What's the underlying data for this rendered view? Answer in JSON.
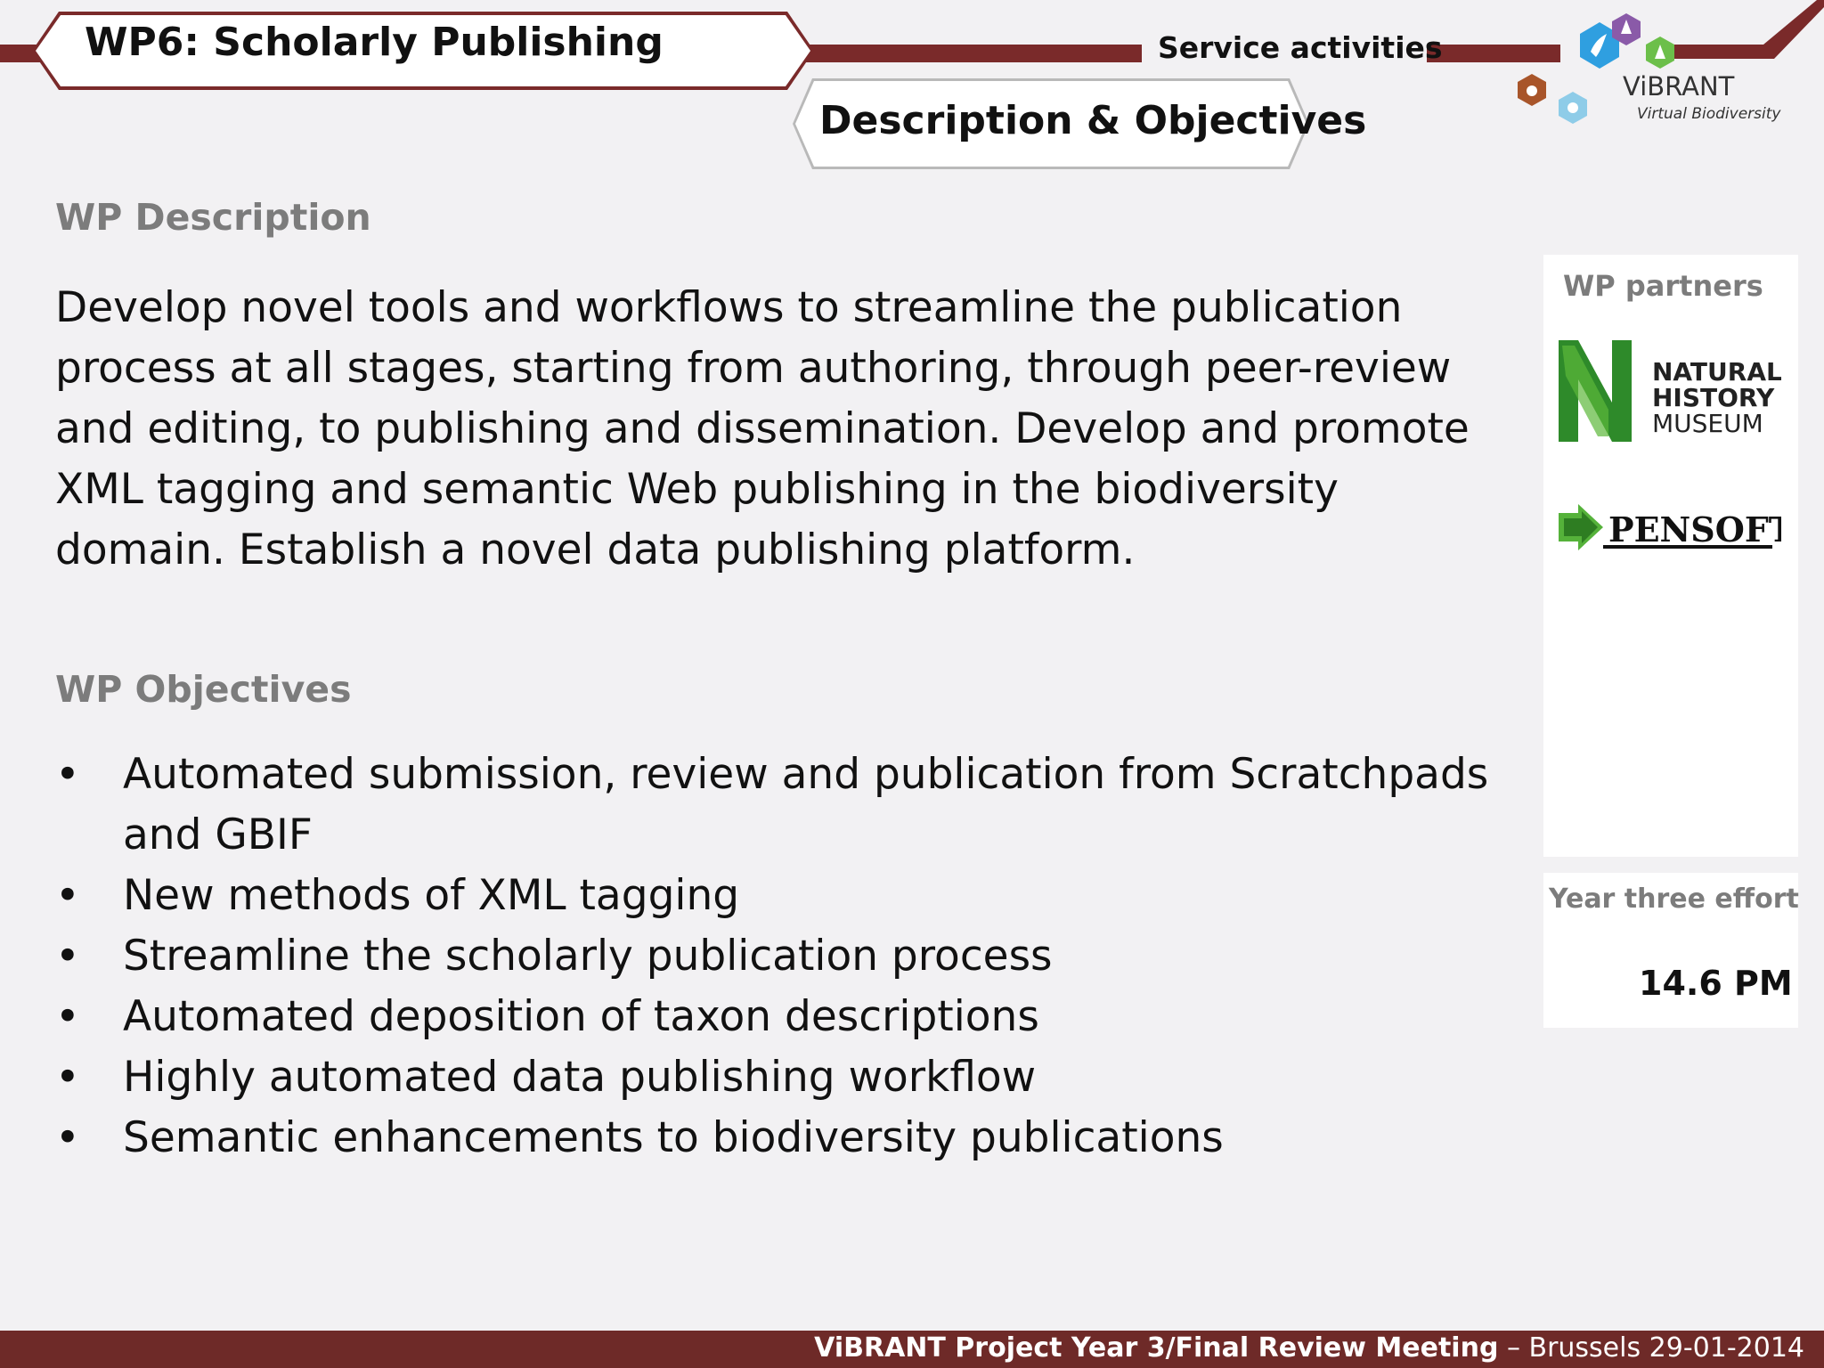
{
  "header": {
    "title": "WP6: Scholarly Publishing",
    "section": "Service activities",
    "tab": "Description & Objectives"
  },
  "logo": {
    "name": "ViBRANT",
    "subtitle": "Virtual Biodiversity"
  },
  "description": {
    "heading": "WP Description",
    "text": "Develop novel tools and workflows to streamline the publication process at all stages, starting from authoring, through peer-review and editing, to publishing and dissemination. Develop and promote XML tagging and semantic Web publishing in the biodiversity domain. Establish a novel data publishing platform."
  },
  "objectives": {
    "heading": "WP Objectives",
    "bullet": "•",
    "items": [
      "Automated submission, review and publication from Scratchpads and GBIF",
      "New methods of XML tagging",
      "Streamline the scholarly publication process",
      "Automated deposition of taxon descriptions",
      "Highly automated data publishing workflow",
      "Semantic enhancements to biodiversity publications"
    ]
  },
  "partners": {
    "label": "WP partners",
    "nhm": [
      "NATURAL",
      "HISTORY",
      "MUSEUM"
    ],
    "pensoft": "PENSOFT"
  },
  "effort": {
    "label": "Year three effort",
    "value": "14.6 PM"
  },
  "footer": {
    "meeting": "ViBRANT Project Year 3/Final Review Meeting",
    "place_date": " – Brussels 29-01-2014"
  },
  "colors": {
    "brand": "#7a2a2a",
    "footer": "#6e2a28",
    "heading_grey": "#7c7c7c"
  }
}
